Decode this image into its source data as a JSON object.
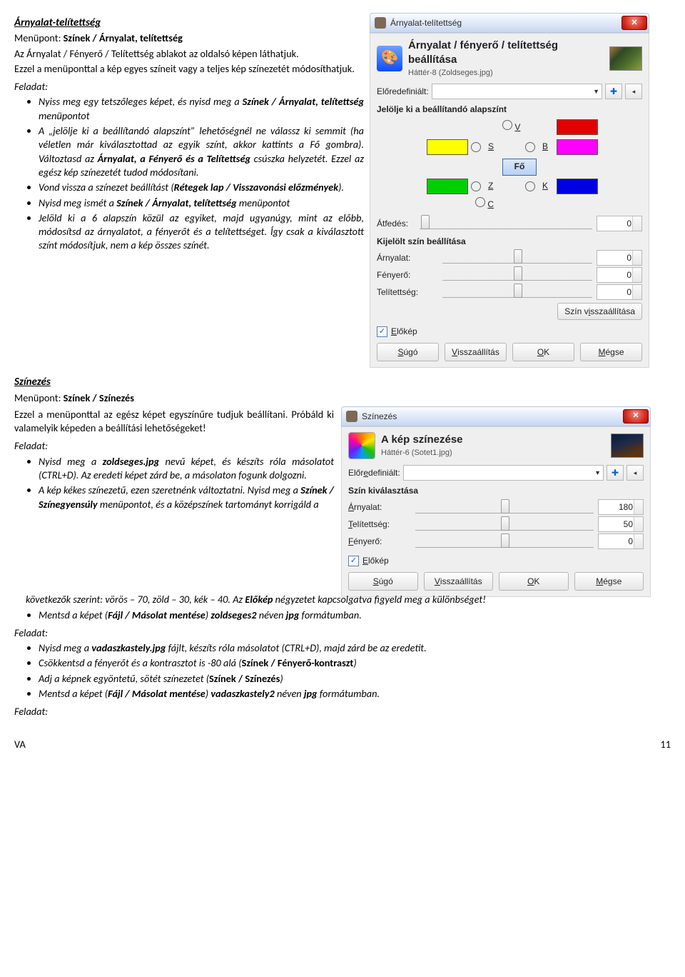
{
  "sec1": {
    "title": "Árnyalat-telítettség",
    "menuLine_prefix": "Menüpont: ",
    "menuLine_bold": "Színek / Árnyalat, telítettség",
    "p1a": "Az Árnyalat / Fényerő / Telítettség ablakot az oldalsó képen láthatjuk.",
    "p1b": "Ezzel a menüponttal a kép egyes színeit vagy a teljes kép színezetét módosíthatjuk.",
    "feladat": "Feladat:",
    "t1_a": "Nyiss meg egy tetszőleges képet, és nyisd meg a ",
    "t1_b": "Színek / Árnyalat, telítettség",
    "t1_c": " menüpontot",
    "t2_a": "A „jelölje ki a beállítandó alapszínt” lehetőségnél ne válassz ki semmit (ha véletlen már kiválasztottad az egyik színt, akkor kattints a Fő gombra). Változtasd az ",
    "t2_b": "Árnyalat, a Fényerő és a Telítettség",
    "t2_c": " csúszka helyzetét. Ezzel az egész kép színezetét tudod módosítani.",
    "t3_a": "Vond vissza a színezet beállítást (",
    "t3_b": "Rétegek lap / Visszavonási előzmények",
    "t3_c": ").",
    "t4_a": "Nyisd meg ismét a ",
    "t4_b": "Színek / Árnyalat, telítettség",
    "t4_c": " menüpontot",
    "t5": "Jelöld ki a 6 alapszín közül az egyiket, majd ugyanúgy, mint az előbb, módosítsd az árnyalatot, a fényerőt és a telítettséget. Így csak a kiválasztott színt módosítjuk, nem a kép összes színét."
  },
  "dlg1": {
    "windowTitle": "Árnyalat-telítettség",
    "bigTitle": "Árnyalat / fényerő / telítettség beállítása",
    "sub": "Háttér-8 (Zoldseges.jpg)",
    "presetsLabel": "Előredefiniált:",
    "pickHeading": "Jelölje ki a beállítandó alapszínt",
    "letters": {
      "V": "V",
      "S": "S",
      "B": "B",
      "Z": "Z",
      "K": "K",
      "C": "C"
    },
    "fo": "Fő",
    "overlap": "Átfedés:",
    "selHeading": "Kijelölt szín beállítása",
    "hue": "Árnyalat:",
    "bright": "Fényerő:",
    "sat": "Telítettség:",
    "resetColor": "Szín visszaállítása",
    "preview": "Előkép",
    "help": "Súgó",
    "reset": "Visszaállítás",
    "ok": "OK",
    "cancel": "Mégse",
    "zero": "0"
  },
  "sec2": {
    "title": "Színezés",
    "menuLine_prefix": "Menüpont: ",
    "menuLine_bold": "Színek / Színezés",
    "p1": "Ezzel a menüponttal az egész képet egyszínűre tudjuk beállítani. Próbáld ki valamelyik képeden a beállítási lehetőségeket!",
    "feladatA": "Feladat:",
    "a1_a": "Nyisd meg a ",
    "a1_b": "zoldseges.jpg",
    "a1_c": " nevű képet, és készíts róla másolatot (CTRL+D). Az eredeti képet zárd be, a másolaton fogunk dolgozni.",
    "a2_a": "A kép kékes színezetű, ezen szeretnénk változtatni. Nyisd meg a ",
    "a2_b": "Színek / Színegyensúly",
    "a2_c": " menüpontot, és a középszínek tartományt korrigáld a következők szerint: vörös – 70, zöld – 30, kék – 40. Az ",
    "a2_d": "Előkép",
    "a2_e": " négyzetet kapcsolgatva figyeld meg a különbséget!",
    "a3_a": "Mentsd a képet (",
    "a3_b": "Fájl / Másolat mentése",
    "a3_c": ") ",
    "a3_d": "zoldseges2",
    "a3_e": " néven ",
    "a3_f": "jpg",
    "a3_g": " formátumban.",
    "feladatB": "Feladat:",
    "b1_a": "Nyisd meg a ",
    "b1_b": "vadaszkastely.jpg",
    "b1_c": " fájlt, készíts róla másolatot (CTRL+D), majd zárd be az eredetit.",
    "b2_a": "Csökkentsd a fényerőt és a kontrasztot is -80 alá (",
    "b2_b": "Színek / Fényerő-kontraszt",
    "b2_c": ")",
    "b3_a": "Adj a képnek egyöntetű, sötét színezetet (",
    "b3_b": "Színek / Színezés",
    "b3_c": ")",
    "b4_a": "Mentsd a képet (",
    "b4_b": "Fájl / Másolat mentése",
    "b4_c": ") ",
    "b4_d": "vadaszkastely2",
    "b4_e": " néven ",
    "b4_f": "jpg",
    "b4_g": " formátumban.",
    "feladatC": "Feladat:"
  },
  "dlg2": {
    "windowTitle": "Színezés",
    "bigTitle": "A kép színezése",
    "sub": "Háttér-6 (Sotet1.jpg)",
    "presetsLabel": "Előredefiniált:",
    "selHeading": "Szín kiválasztása",
    "hue": "Árnyalat:",
    "hueVal": "180",
    "sat": "Telítettség:",
    "satVal": "50",
    "bright": "Fényerő:",
    "brightVal": "0",
    "preview": "Előkép",
    "help": "Súgó",
    "reset": "Visszaállítás",
    "ok": "OK",
    "cancel": "Mégse"
  },
  "footer": {
    "left": "VA",
    "right": "11"
  }
}
